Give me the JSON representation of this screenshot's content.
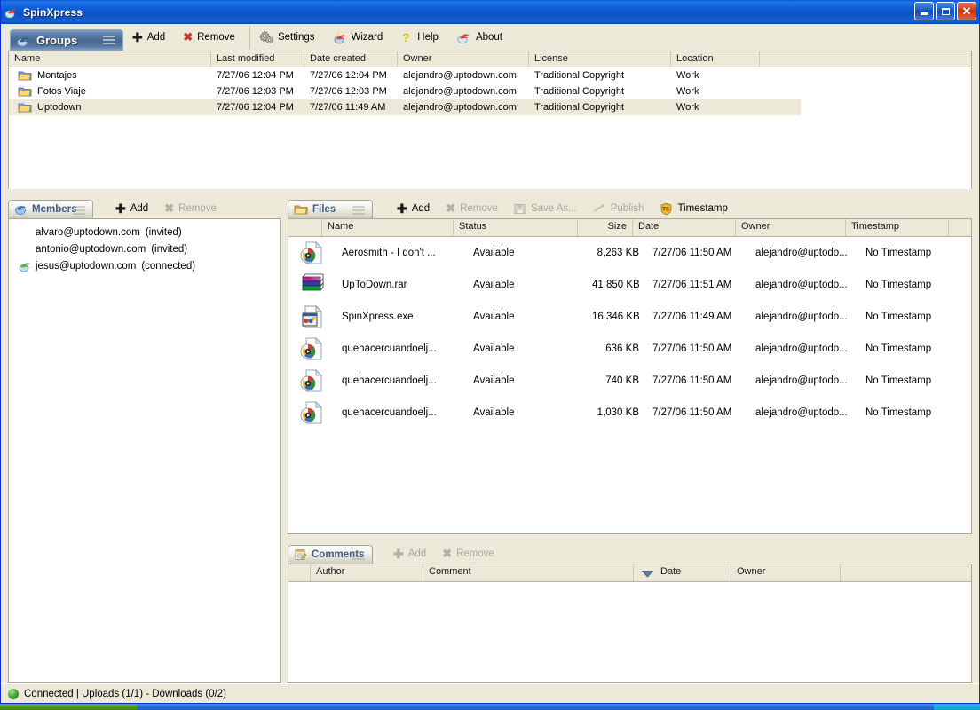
{
  "window": {
    "title": "SpinXpress",
    "title_icon": "spinxpress-logo-icon",
    "minimize_label": "",
    "maximize_label": "",
    "close_label": "✕"
  },
  "main_toolbar": {
    "tab": {
      "label": "Groups",
      "icon": "groups-icon"
    },
    "items": [
      {
        "label": "Add",
        "icon": "plus-icon",
        "enabled": true
      },
      {
        "label": "Remove",
        "icon": "x-red-icon",
        "enabled": true
      },
      {
        "label": "Settings",
        "icon": "gears-icon",
        "enabled": true
      },
      {
        "label": "Wizard",
        "icon": "wizard-icon",
        "enabled": true
      },
      {
        "label": "Help",
        "icon": "question-mark-icon",
        "enabled": true
      },
      {
        "label": "About",
        "icon": "about-icon",
        "enabled": true
      }
    ]
  },
  "groups": {
    "columns": [
      "Name",
      "Last modified",
      "Date created",
      "Owner",
      "License",
      "Location",
      ""
    ],
    "rows": [
      {
        "name": "Montajes",
        "last_modified": "7/27/06 12:04 PM",
        "date_created": "7/27/06 12:04 PM",
        "owner": "alejandro@uptodown.com",
        "license": "Traditional Copyright",
        "location": "Work",
        "selected": false
      },
      {
        "name": "Fotos Viaje",
        "last_modified": "7/27/06 12:03 PM",
        "date_created": "7/27/06 12:03 PM",
        "owner": "alejandro@uptodown.com",
        "license": "Traditional Copyright",
        "location": "Work",
        "selected": false
      },
      {
        "name": "Uptodown",
        "last_modified": "7/27/06 12:04 PM",
        "date_created": "7/27/06 11:49 AM",
        "owner": "alejandro@uptodown.com",
        "license": "Traditional Copyright",
        "location": "Work",
        "selected": true
      }
    ]
  },
  "members": {
    "tab": {
      "label": "Members",
      "icon": "members-icon"
    },
    "toolbar": [
      {
        "label": "Add",
        "icon": "plus-icon",
        "enabled": true
      },
      {
        "label": "Remove",
        "icon": "x-grey-icon",
        "enabled": false
      }
    ],
    "rows": [
      {
        "email": "alvaro@uptodown.com",
        "status": "(invited)",
        "connected": false
      },
      {
        "email": "antonio@uptodown.com",
        "status": "(invited)",
        "connected": false
      },
      {
        "email": "jesus@uptodown.com",
        "status": "(connected)",
        "connected": true
      }
    ]
  },
  "files": {
    "tab": {
      "label": "Files",
      "icon": "folder-icon"
    },
    "toolbar": [
      {
        "label": "Add",
        "icon": "plus-icon",
        "enabled": true
      },
      {
        "label": "Remove",
        "icon": "x-grey-icon",
        "enabled": false
      },
      {
        "label": "Save As...",
        "icon": "save-as-icon",
        "enabled": false
      },
      {
        "label": "Publish",
        "icon": "publish-icon",
        "enabled": false
      },
      {
        "label": "Timestamp",
        "icon": "timestamp-shield-icon",
        "enabled": true
      }
    ],
    "columns": [
      "",
      "Name",
      "Status",
      "Size",
      "Date",
      "Owner",
      "Timestamp",
      ""
    ],
    "rows": [
      {
        "icon": "media-file-icon",
        "name": "Aerosmith - I don't ...",
        "status": "Available",
        "size": "8,263 KB",
        "date": "7/27/06 11:50 AM",
        "owner": "alejandro@uptodo...",
        "timestamp": "No Timestamp"
      },
      {
        "icon": "rar-archive-icon",
        "name": "UpToDown.rar",
        "status": "Available",
        "size": "41,850 KB",
        "date": "7/27/06 11:51 AM",
        "owner": "alejandro@uptodo...",
        "timestamp": "No Timestamp"
      },
      {
        "icon": "exe-file-icon",
        "name": "SpinXpress.exe",
        "status": "Available",
        "size": "16,346 KB",
        "date": "7/27/06 11:49 AM",
        "owner": "alejandro@uptodo...",
        "timestamp": "No Timestamp"
      },
      {
        "icon": "media-file-icon",
        "name": "quehacercuandoelj...",
        "status": "Available",
        "size": "636 KB",
        "date": "7/27/06 11:50 AM",
        "owner": "alejandro@uptodo...",
        "timestamp": "No Timestamp"
      },
      {
        "icon": "media-file-icon",
        "name": "quehacercuandoelj...",
        "status": "Available",
        "size": "740 KB",
        "date": "7/27/06 11:50 AM",
        "owner": "alejandro@uptodo...",
        "timestamp": "No Timestamp"
      },
      {
        "icon": "media-file-icon",
        "name": "quehacercuandoelj...",
        "status": "Available",
        "size": "1,030 KB",
        "date": "7/27/06 11:50 AM",
        "owner": "alejandro@uptodo...",
        "timestamp": "No Timestamp"
      }
    ]
  },
  "comments": {
    "tab": {
      "label": "Comments",
      "icon": "comments-icon"
    },
    "toolbar": [
      {
        "label": "Add",
        "icon": "plus-icon",
        "enabled": false
      },
      {
        "label": "Remove",
        "icon": "x-grey-icon",
        "enabled": false
      }
    ],
    "columns": [
      "",
      "Author",
      "Comment",
      "Date",
      "Owner",
      ""
    ],
    "sort_column": "Date",
    "sort_direction": "desc",
    "rows": []
  },
  "statusbar": {
    "indicator": "green-led-icon",
    "text": "Connected  |  Uploads (1/1) - Downloads (0/2)"
  },
  "colors": {
    "titlebar_blue": "#0c5ad4",
    "window_face": "#ece9d8",
    "tab_blue": "#47688f",
    "selection": "#ece9d8",
    "accent_red": "#c0392b",
    "status_green": "#3f9f33"
  }
}
